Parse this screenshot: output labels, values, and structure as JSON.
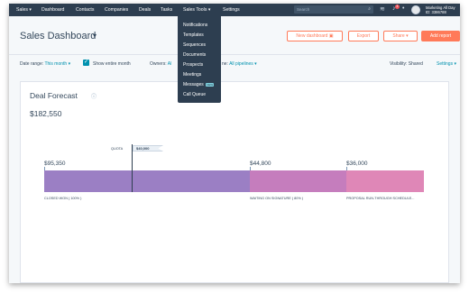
{
  "topnav": {
    "items": [
      "Sales",
      "Dashboard",
      "Contacts",
      "Companies",
      "Deals",
      "Tasks",
      "Sales Tools",
      "Settings"
    ],
    "search_placeholder": "Search",
    "notification_count": "4",
    "account_name": "Marketing All Day",
    "account_id": "ID: 3386788"
  },
  "dropdown": {
    "items": [
      "Notifications",
      "Templates",
      "Sequences",
      "Documents",
      "Prospects",
      "Meetings",
      "Messages",
      "Call Queue"
    ],
    "new_badge": "NEW"
  },
  "header": {
    "title": "Sales Dashboard",
    "new_dashboard": "New dashboard",
    "export": "Export",
    "share": "Share",
    "add_report": "Add report"
  },
  "filters": {
    "date_range_label": "Date range:",
    "date_range_value": "This month",
    "entire_month": "Show entire month",
    "owners_label": "Owners:",
    "owners_value": "Al",
    "pipeline_label": "ne:",
    "pipeline_value": "All pipelines",
    "visibility_label": "Visibility:",
    "visibility_value": "Shared",
    "settings": "Settings"
  },
  "card": {
    "title": "Deal Forecast",
    "total": "$182,550",
    "quota_label": "QUOTA",
    "quota_value": "$40,000",
    "segments": [
      {
        "value": "$95,350",
        "label": "CLOSED WON ( 100% )",
        "color": "#9b7fc4"
      },
      {
        "value": "$44,800",
        "label": "WAITING ON SIGNATURE ( 80% )",
        "color": "#c57dbd"
      },
      {
        "value": "$36,000",
        "label": "PROPOSAL RUN-THROUGH SCHEDULE...",
        "color": "#df87b7"
      }
    ]
  },
  "colors": {
    "nav_bg": "#2d3e50",
    "accent": "#ff7a59",
    "link": "#0091ae"
  }
}
